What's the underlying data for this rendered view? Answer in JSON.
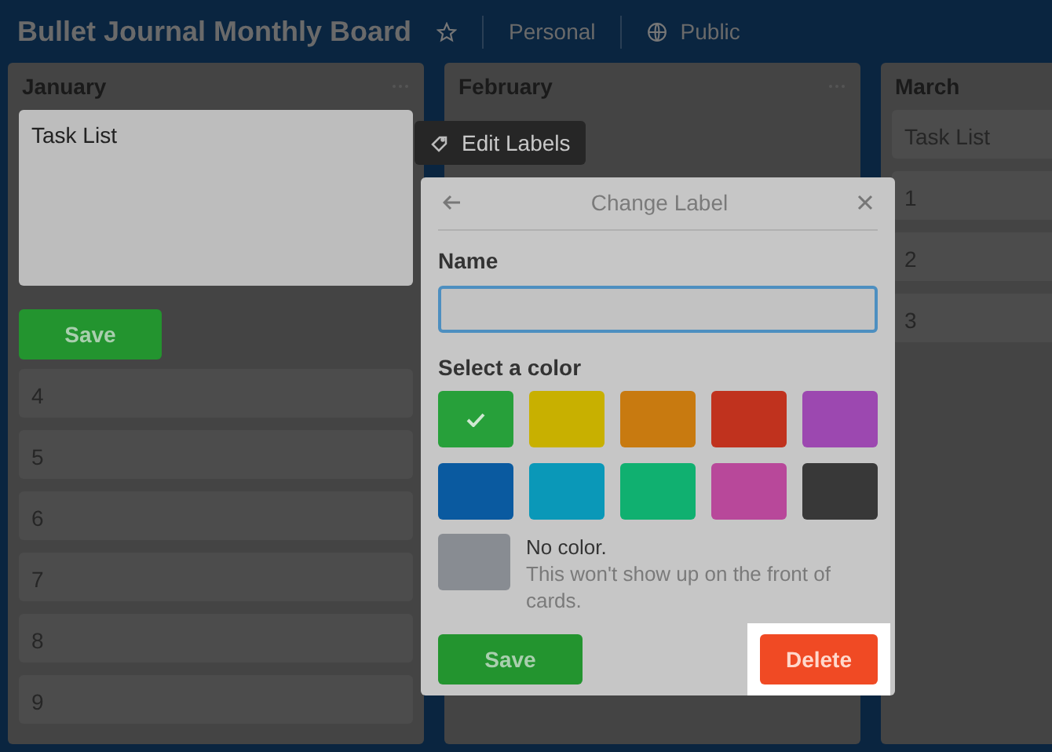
{
  "board": {
    "title": "Bullet Journal Monthly Board",
    "team": "Personal",
    "visibility": "Public"
  },
  "lists": [
    {
      "title": "January",
      "has_menu": true,
      "editing_card": {
        "text": "Task List",
        "save": "Save"
      },
      "cards": [
        "4",
        "5",
        "6",
        "7",
        "8",
        "9"
      ]
    },
    {
      "title": "February",
      "has_menu": true
    },
    {
      "title": "March",
      "cards": [
        "Task List",
        "1",
        "2",
        "3"
      ]
    }
  ],
  "edit_labels": {
    "label": "Edit Labels"
  },
  "popup": {
    "title": "Change Label",
    "name_label": "Name",
    "color_label": "Select a color",
    "colors": [
      {
        "color": "#27a03a",
        "selected": true
      },
      {
        "color": "#c8b000",
        "selected": false
      },
      {
        "color": "#c87a10",
        "selected": false
      },
      {
        "color": "#c0321e",
        "selected": false
      },
      {
        "color": "#9c48b0",
        "selected": false
      },
      {
        "color": "#0a5aa0",
        "selected": false
      },
      {
        "color": "#0a98b8",
        "selected": false
      },
      {
        "color": "#10b070",
        "selected": false
      },
      {
        "color": "#b8489a",
        "selected": false
      },
      {
        "color": "#383838",
        "selected": false
      }
    ],
    "no_color": {
      "title": "No color.",
      "note": "This won't show up on the front of cards."
    },
    "save": "Save",
    "delete": "Delete"
  }
}
